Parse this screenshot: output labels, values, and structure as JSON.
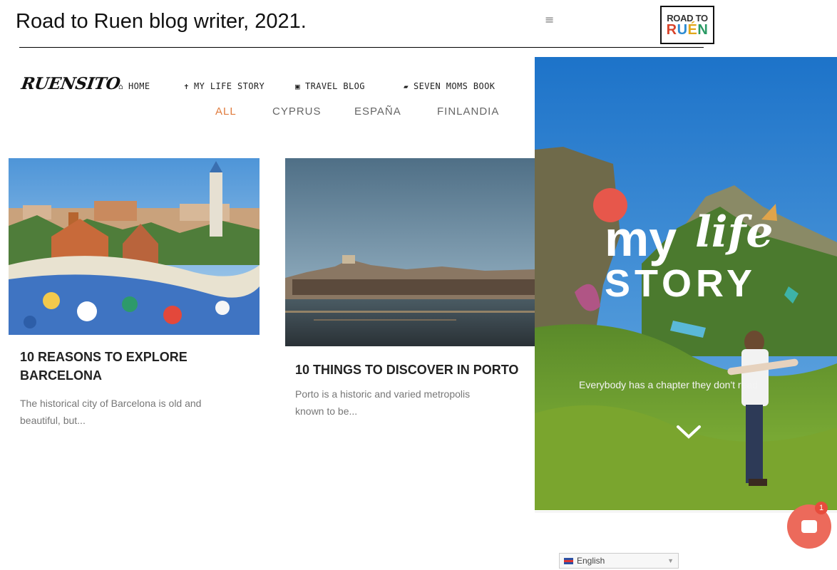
{
  "slide": {
    "title": "Road to Ruen blog writer, 2021."
  },
  "brand": {
    "logo_line1": "ROAD TO",
    "logo_line2": [
      "R",
      "U",
      "É",
      "N"
    ],
    "menu_icon": "hamburger-icon"
  },
  "site": {
    "logo": "RUENSITO",
    "nav": [
      {
        "icon": "home-icon",
        "glyph": "⌂",
        "label": "HOME"
      },
      {
        "icon": "person-icon",
        "glyph": "✝",
        "label": "MY LIFE STORY"
      },
      {
        "icon": "bus-icon",
        "glyph": "▣",
        "label": "TRAVEL BLOG"
      },
      {
        "icon": "book-icon",
        "glyph": "▰",
        "label": "SEVEN MOMS BOOK"
      }
    ],
    "filters": [
      "ALL",
      "CYPRUS",
      "ESPAÑA",
      "FINLANDIA"
    ],
    "active_filter": "ALL"
  },
  "posts": [
    {
      "title": "10 REASONS TO EXPLORE BARCELONA",
      "excerpt": "The historical city of Barcelona is old and beautiful, but..."
    },
    {
      "title": "10 THINGS TO DISCOVER IN PORTO",
      "excerpt": "Porto is a historic and varied metropolis known to be..."
    }
  ],
  "hero": {
    "title_my": "my",
    "title_life": "life",
    "title_story": "STORY",
    "tagline": "Everybody has a chapter they don't read"
  },
  "chat": {
    "badge": "1"
  },
  "language": {
    "label": "English"
  },
  "colors": {
    "accent_orange": "#e07b3d",
    "chat_red": "#ec6a5b"
  }
}
